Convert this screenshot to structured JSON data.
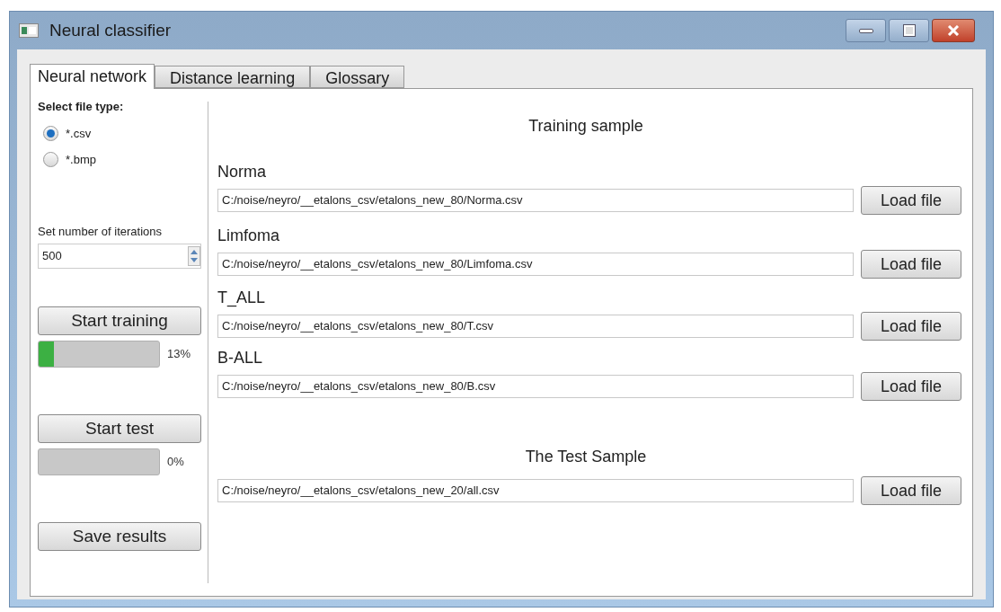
{
  "window": {
    "title": "Neural classifier"
  },
  "tabs": [
    {
      "label": "Neural network",
      "selected": true
    },
    {
      "label": "Distance learning",
      "selected": false
    },
    {
      "label": "Glossary",
      "selected": false
    }
  ],
  "file_type": {
    "label": "Select file type:",
    "options": [
      {
        "label": "*.csv",
        "selected": true
      },
      {
        "label": "*.bmp",
        "selected": false
      }
    ]
  },
  "iterations": {
    "label": "Set number of iterations",
    "value": "500"
  },
  "training": {
    "button": "Start training",
    "level": 0.13,
    "reading": "13%"
  },
  "test": {
    "button": "Start test",
    "level": 0,
    "reading": "0%"
  },
  "save_button": "Save results",
  "training_sample": {
    "title": "Training sample",
    "files": [
      {
        "label": "Norma",
        "path": "C:/noise/neyro/__etalons_csv/etalons_new_80/Norma.csv",
        "button": "Load file"
      },
      {
        "label": "Limfoma",
        "path": "C:/noise/neyro/__etalons_csv/etalons_new_80/Limfoma.csv",
        "button": "Load file"
      },
      {
        "label": "T_ALL",
        "path": "C:/noise/neyro/__etalons_csv/etalons_new_80/T.csv",
        "button": "Load file"
      },
      {
        "label": "B-ALL",
        "path": "C:/noise/neyro/__etalons_csv/etalons_new_80/B.csv",
        "button": "Load file"
      }
    ]
  },
  "test_sample": {
    "title": "The Test Sample",
    "path": "C:/noise/neyro/__etalons_csv/etalons_new_20/all.csv",
    "button": "Load file"
  }
}
